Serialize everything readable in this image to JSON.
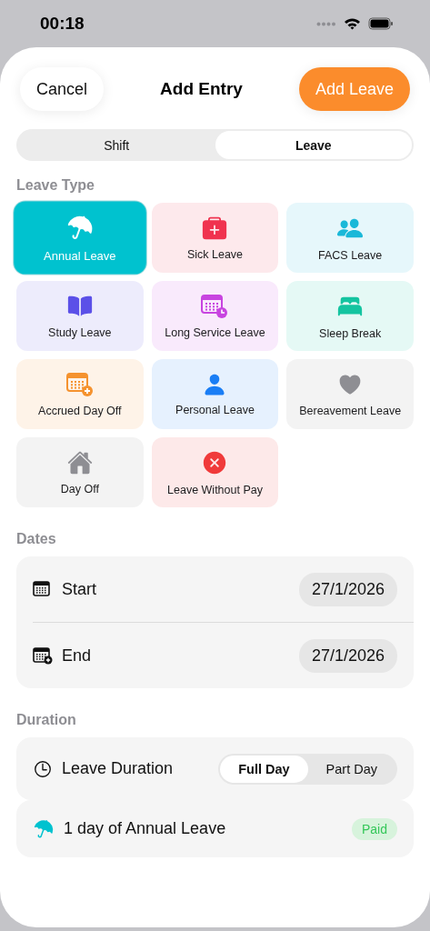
{
  "status_bar": {
    "time": "00:18"
  },
  "header": {
    "cancel": "Cancel",
    "title": "Add Entry",
    "action": "Add Leave"
  },
  "mode_tabs": [
    {
      "label": "Shift",
      "selected": false
    },
    {
      "label": "Leave",
      "selected": true
    }
  ],
  "leave_type": {
    "heading": "Leave Type",
    "options": [
      {
        "label": "Annual Leave",
        "color": "#00c2cf",
        "selected": true
      },
      {
        "label": "Sick Leave",
        "color": "#f0334f",
        "selected": false
      },
      {
        "label": "FACS Leave",
        "color": "#1ab8d8",
        "selected": false
      },
      {
        "label": "Study Leave",
        "color": "#5b50e8",
        "selected": false
      },
      {
        "label": "Long Service Leave",
        "color": "#c844e0",
        "selected": false
      },
      {
        "label": "Sleep Break",
        "color": "#14c4a0",
        "selected": false
      },
      {
        "label": "Accrued Day Off",
        "color": "#f5922e",
        "selected": false
      },
      {
        "label": "Personal Leave",
        "color": "#1a7ef5",
        "selected": false
      },
      {
        "label": "Bereavement Leave",
        "color": "#8e8e93",
        "selected": false
      },
      {
        "label": "Day Off",
        "color": "#8e8e93",
        "selected": false
      },
      {
        "label": "Leave Without Pay",
        "color": "#f03a3a",
        "selected": false
      }
    ]
  },
  "dates": {
    "heading": "Dates",
    "rows": [
      {
        "label": "Start",
        "value": "27/1/2026"
      },
      {
        "label": "End",
        "value": "27/1/2026"
      }
    ]
  },
  "duration": {
    "heading": "Duration",
    "label": "Leave Duration",
    "options": [
      {
        "label": "Full Day",
        "selected": true
      },
      {
        "label": "Part Day",
        "selected": false
      }
    ]
  },
  "summary": {
    "text": "1 day of Annual Leave",
    "badge": "Paid"
  }
}
